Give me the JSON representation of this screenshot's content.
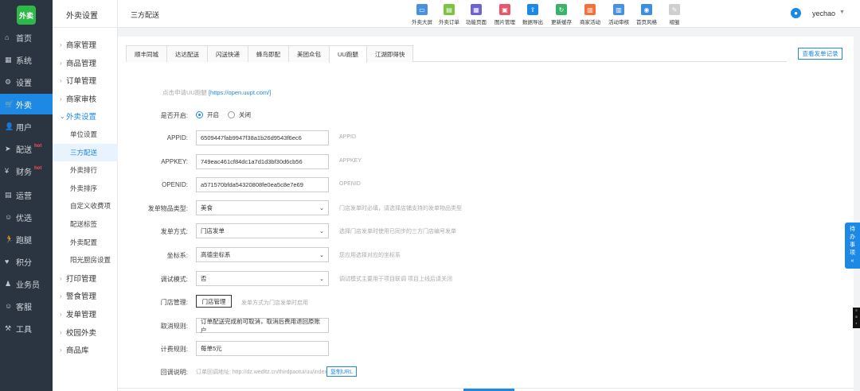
{
  "logo": "外卖",
  "main_nav": [
    {
      "icon": "⌂",
      "label": "首页",
      "hot": ""
    },
    {
      "icon": "▦",
      "label": "系统",
      "hot": ""
    },
    {
      "icon": "⚙",
      "label": "设置",
      "hot": ""
    },
    {
      "icon": "🛒",
      "label": "外卖",
      "hot": ""
    },
    {
      "icon": "👤",
      "label": "用户",
      "hot": ""
    },
    {
      "icon": "➤",
      "label": "配送",
      "hot": "hot"
    },
    {
      "icon": "¥",
      "label": "财务",
      "hot": "hot"
    },
    {
      "icon": "▤",
      "label": "运营",
      "hot": ""
    },
    {
      "icon": "☺",
      "label": "优选",
      "hot": ""
    },
    {
      "icon": "🏃",
      "label": "跑腿",
      "hot": ""
    },
    {
      "icon": "♥",
      "label": "积分",
      "hot": ""
    },
    {
      "icon": "♟",
      "label": "业务员",
      "hot": ""
    },
    {
      "icon": "☺",
      "label": "客服",
      "hot": ""
    },
    {
      "icon": "⚒",
      "label": "工具",
      "hot": ""
    }
  ],
  "sub_nav": {
    "title": "外卖设置",
    "items_before": [
      "商家管理",
      "商品管理",
      "订单管理",
      "商家审核"
    ],
    "open_group": "外卖设置",
    "children": [
      "单位设置",
      "三方配送",
      "外卖排行",
      "外卖排序",
      "自定义收费项",
      "配送标签",
      "外卖配置",
      "阳光厨房设置"
    ],
    "items_after": [
      "打印管理",
      "警食管理",
      "发单管理",
      "校园外卖",
      "商品库"
    ]
  },
  "header": {
    "title": "三方配送",
    "tools": [
      {
        "label": "外卖大屏",
        "color": "#4a90e2",
        "glyph": "▭"
      },
      {
        "label": "外卖订单",
        "color": "#7cc443",
        "glyph": "▤"
      },
      {
        "label": "功能页面",
        "color": "#6f62d6",
        "glyph": "▦"
      },
      {
        "label": "图片管理",
        "color": "#e9566b",
        "glyph": "▣"
      },
      {
        "label": "数据导出",
        "color": "#1e88e5",
        "glyph": "⇪"
      },
      {
        "label": "更新缓存",
        "color": "#3ab36a",
        "glyph": "↻"
      },
      {
        "label": "商家活动",
        "color": "#f4713a",
        "glyph": "▥"
      },
      {
        "label": "活动审核",
        "color": "#4a90e2",
        "glyph": "▥"
      },
      {
        "label": "首页风格",
        "color": "#3c8fe0",
        "glyph": "◉"
      },
      {
        "label": "褶皱",
        "color": "#cfcfcf",
        "glyph": "✎"
      }
    ],
    "user": "yechao"
  },
  "tabs": [
    "顺丰同城",
    "达达配送",
    "闪送快递",
    "蜂鸟即配",
    "美团众包",
    "UU跑腿",
    "江湖即得快"
  ],
  "active_tab": "UU跑腿",
  "view_log": "查看发单记录",
  "apply": {
    "prefix": "点击申请UU跑腿",
    "url": "https://open.uupt.com/"
  },
  "form": {
    "enable_label": "是否开启:",
    "enable_on": "开启",
    "enable_off": "关闭",
    "appid_label": "APPID:",
    "appid_value": "6509447fab9947f38a1b26d9543f6ec6",
    "appid_hint": "APPID",
    "appkey_label": "APPKEY:",
    "appkey_value": "749eac461cf84dc1a7d1d3bf30d6cb56",
    "appkey_hint": "APPKEY",
    "openid_label": "OPENID:",
    "openid_value": "a571570bfda54320808fe0ea5c8e7e69",
    "openid_hint": "OPENID",
    "goods_type_label": "发单物品类型:",
    "goods_type_value": "美食",
    "goods_type_hint": "门店发单时必填，请选择店铺支持的发单物品类型",
    "send_mode_label": "发单方式:",
    "send_mode_value": "门店发单",
    "send_mode_hint": "选择门店发单时使用已同步的三方门店编号发单",
    "coord_label": "坐标系:",
    "coord_value": "高德坐标系",
    "coord_hint": "您应用选择对应的坐标系",
    "debug_label": "调试模式:",
    "debug_value": "否",
    "debug_hint": "调试模式主要用于项目联调 项目上线后请关闭",
    "store_label": "门店管理:",
    "store_btn": "门店管理",
    "store_hint": "发单方式为门店发单时启用",
    "cancel_label": "取消规则:",
    "cancel_value": "订单配送完成前可取消，取消后费用退回原账户",
    "fee_label": "计费规则:",
    "fee_value": "每单5元",
    "callback_label": "回调说明:",
    "callback_text": "订单回调地址: http://dz.wedltz.cn/thirdpaotui/uu/index",
    "copy_btn": "复制URL"
  },
  "todo": [
    "待",
    "办",
    "事",
    "项",
    "«"
  ],
  "mini_badge": [
    "≡",
    "5",
    "▪"
  ]
}
